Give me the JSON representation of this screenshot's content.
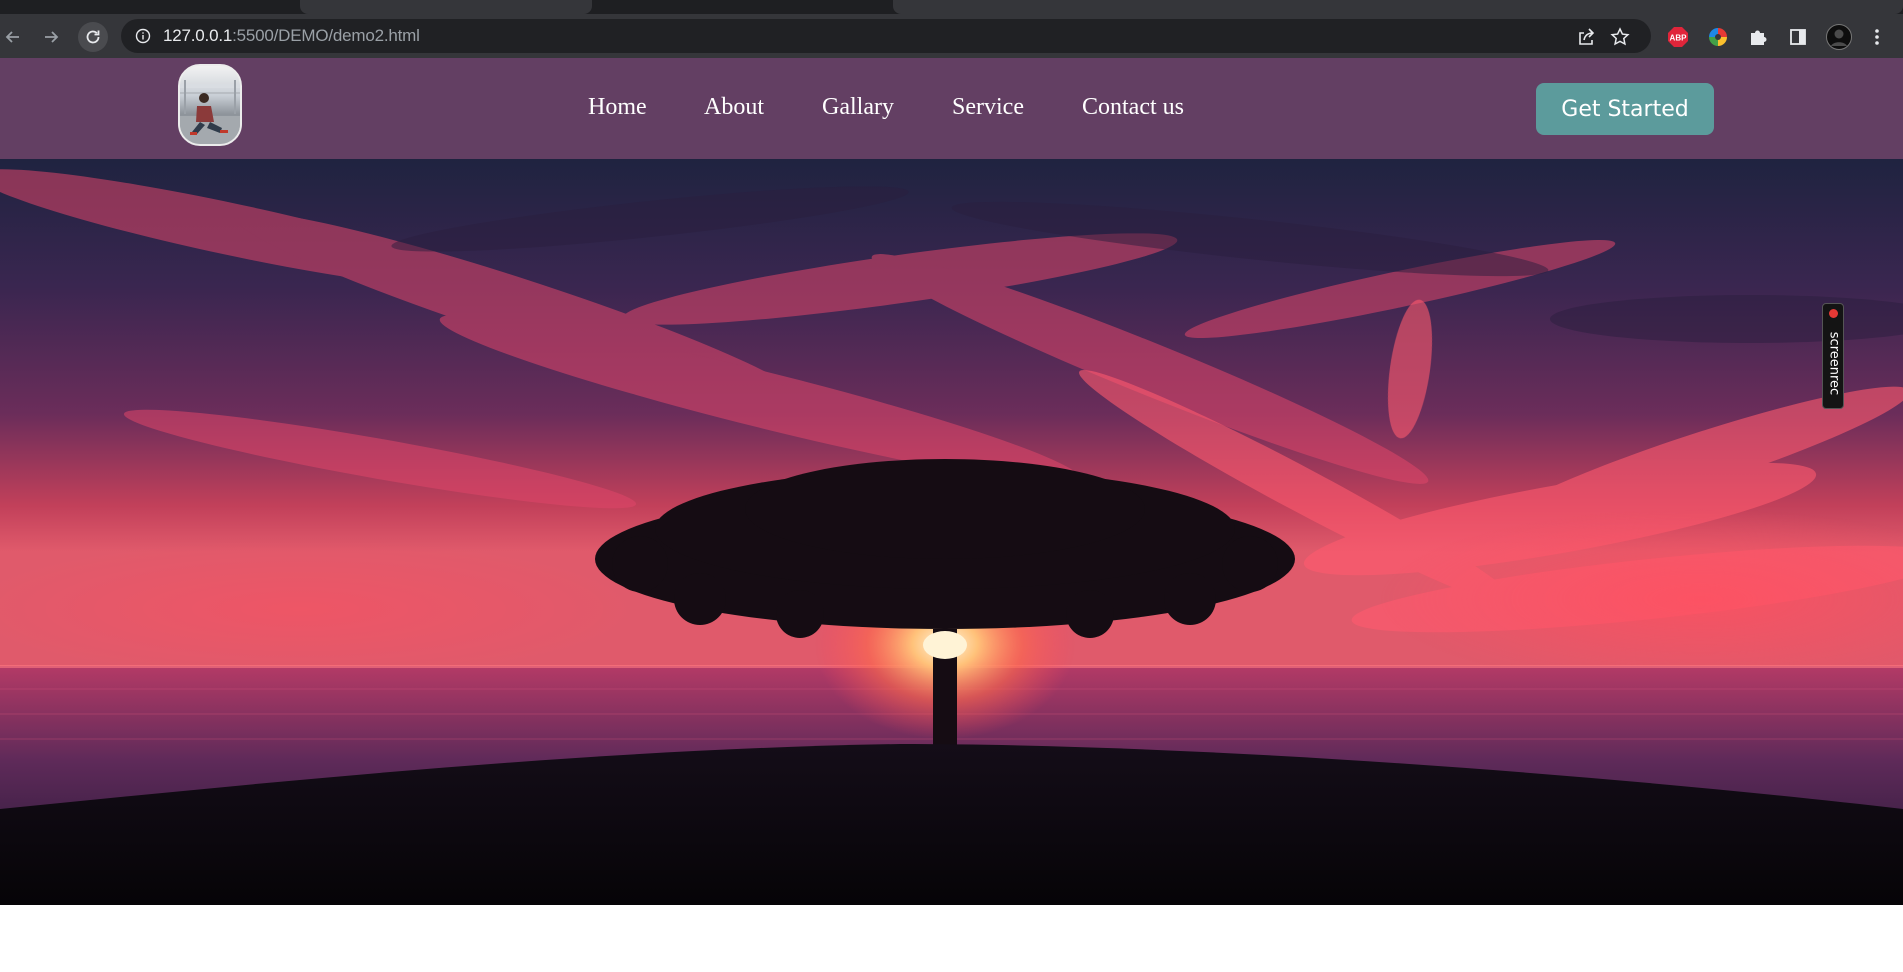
{
  "browser": {
    "url_host": "127.0.0.1",
    "url_path": ":5500/DEMO/demo2.html",
    "icons": [
      "back-icon",
      "forward-icon",
      "reload-icon",
      "site-info-icon",
      "share-icon",
      "bookmark-star-icon",
      "adblock-extension-icon",
      "color-picker-extension-icon",
      "extensions-puzzle-icon",
      "side-panel-icon",
      "profile-avatar",
      "menu-kebab-icon"
    ],
    "adblock_label": "ABP"
  },
  "header": {
    "nav": [
      "Home",
      "About",
      "Gallary",
      "Service",
      "Contact us"
    ],
    "cta_label": "Get Started",
    "colors": {
      "header_bg": "#633f63",
      "cta_bg": "#5c9b9c"
    }
  },
  "overlay": {
    "screenrec_label": "screenrec"
  }
}
